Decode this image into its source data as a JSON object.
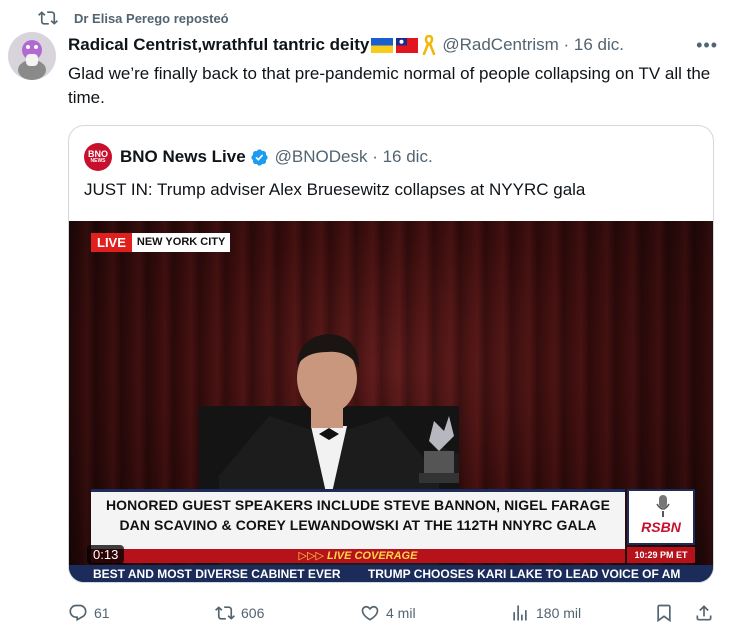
{
  "repost": {
    "text": "Dr Elisa Perego reposteó"
  },
  "tweet": {
    "name": "Radical Centrist,wrathful tantric deity",
    "handle": "@RadCentrism",
    "date": "16 dic.",
    "text": "Glad we’re finally back to that pre-pandemic normal of people collapsing on TV all the time."
  },
  "quote": {
    "logo_line1": "BNO",
    "logo_line2": "NEWS",
    "name": "BNO News Live",
    "handle": "@BNODesk",
    "date": "16 dic.",
    "text": "JUST IN: Trump adviser Alex Bruesewitz collapses at NYYRC gala"
  },
  "video": {
    "live": "LIVE",
    "location": "NEW YORK CITY",
    "lower_third_1": "HONORED GUEST SPEAKERS INCLUDE STEVE BANNON, NIGEL FARAGE",
    "lower_third_2": "DAN SCAVINO & COREY LEWANDOWSKI AT THE 112TH NNYRC GALA",
    "live_coverage": "▷▷▷ LIVE COVERAGE",
    "rsbn": "RSBN",
    "time": "10:29 PM ET",
    "ticker_1": "BEST AND MOST DIVERSE CABINET EVER",
    "ticker_2": "TRUMP CHOOSES KARI LAKE TO LEAD VOICE OF AM",
    "elapsed": "0:13"
  },
  "actions": {
    "replies": "61",
    "reposts": "606",
    "likes": "4 mil",
    "views": "180 mil"
  },
  "colors": {
    "text_primary": "#0f1419",
    "text_secondary": "#536471",
    "verified": "#1d9bf0",
    "border": "#cfd9de"
  },
  "icons": [
    "repost-icon",
    "more-icon",
    "verified-icon",
    "reply-icon",
    "like-icon",
    "views-icon",
    "bookmark-icon",
    "share-icon",
    "ukraine-flag-icon",
    "taiwan-flag-icon",
    "ribbon-icon"
  ]
}
